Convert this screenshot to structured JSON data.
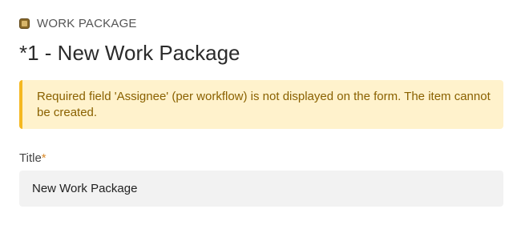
{
  "header": {
    "type_icon": "work-package-icon",
    "type_label": "WORK PACKAGE",
    "title": "*1 - New Work Package"
  },
  "warning": {
    "message": "Required field 'Assignee' (per workflow) is not displayed on the form. The item cannot be created."
  },
  "form": {
    "title_field": {
      "label": "Title",
      "required_marker": "*",
      "value": "New Work Package"
    }
  },
  "colors": {
    "warning_background": "#fff2cc",
    "warning_border": "#f5b820",
    "warning_text": "#8a6100",
    "required_marker": "#d98a2a",
    "input_background": "#f2f2f2"
  }
}
